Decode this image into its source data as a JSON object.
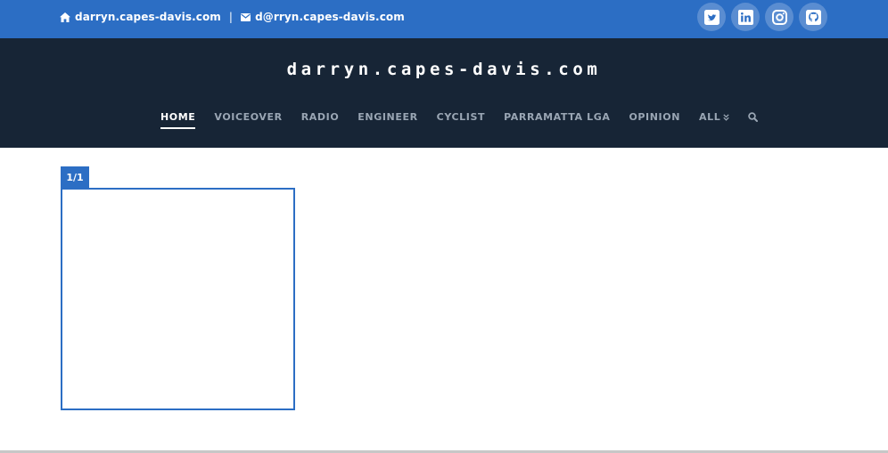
{
  "topbar": {
    "site_link": "darryn.capes-davis.com",
    "separator": "|",
    "email": "d@rryn.capes-davis.com",
    "socials": [
      "twitter-icon",
      "linkedin-icon",
      "instagram-icon",
      "github-icon"
    ]
  },
  "header": {
    "site_title": "darryn.capes-davis.com",
    "nav": [
      {
        "label": "HOME",
        "active": true
      },
      {
        "label": "VOICEOVER",
        "active": false
      },
      {
        "label": "RADIO",
        "active": false
      },
      {
        "label": "ENGINEER",
        "active": false
      },
      {
        "label": "CYCLIST",
        "active": false
      },
      {
        "label": "PARRAMATTA LGA",
        "active": false
      },
      {
        "label": "OPINION",
        "active": false
      },
      {
        "label": "ALL",
        "active": false
      }
    ]
  },
  "gallery": {
    "counter": "1/1"
  },
  "colors": {
    "topbar": "#2c6ec4",
    "header": "#172536",
    "nav_inactive": "#9aa6b4",
    "accent": "#2c6ec4"
  }
}
